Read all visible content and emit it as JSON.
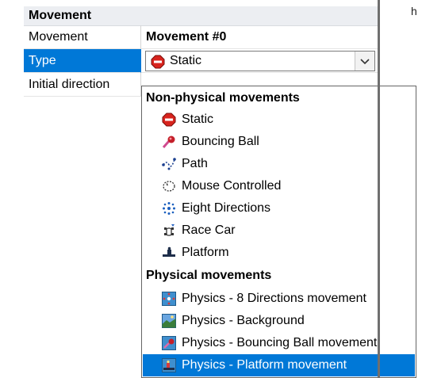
{
  "section": {
    "title": "Movement"
  },
  "properties": {
    "movement": {
      "label": "Movement",
      "value": "Movement #0"
    },
    "type": {
      "label": "Type",
      "value": "Static"
    },
    "initial_direction": {
      "label": "Initial direction"
    }
  },
  "dropdown": {
    "groups": [
      {
        "title": "Non-physical movements",
        "items": [
          {
            "label": "Static",
            "icon": "stop-sign-icon"
          },
          {
            "label": "Bouncing Ball",
            "icon": "bouncing-ball-icon"
          },
          {
            "label": "Path",
            "icon": "path-icon"
          },
          {
            "label": "Mouse Controlled",
            "icon": "mouse-controlled-icon"
          },
          {
            "label": "Eight Directions",
            "icon": "eight-directions-icon"
          },
          {
            "label": "Race Car",
            "icon": "race-car-icon"
          },
          {
            "label": "Platform",
            "icon": "platform-icon"
          }
        ]
      },
      {
        "title": "Physical movements",
        "items": [
          {
            "label": "Physics - 8 Directions movement",
            "icon": "physics-eight-directions-icon"
          },
          {
            "label": "Physics - Background",
            "icon": "physics-background-icon"
          },
          {
            "label": "Physics - Bouncing Ball movement",
            "icon": "physics-bouncing-ball-icon"
          },
          {
            "label": "Physics - Platform movement",
            "icon": "physics-platform-icon",
            "highlighted": true
          }
        ]
      }
    ]
  },
  "right_fragment": "h",
  "colors": {
    "selection": "#0078d7",
    "header_bg": "#eceef2"
  }
}
